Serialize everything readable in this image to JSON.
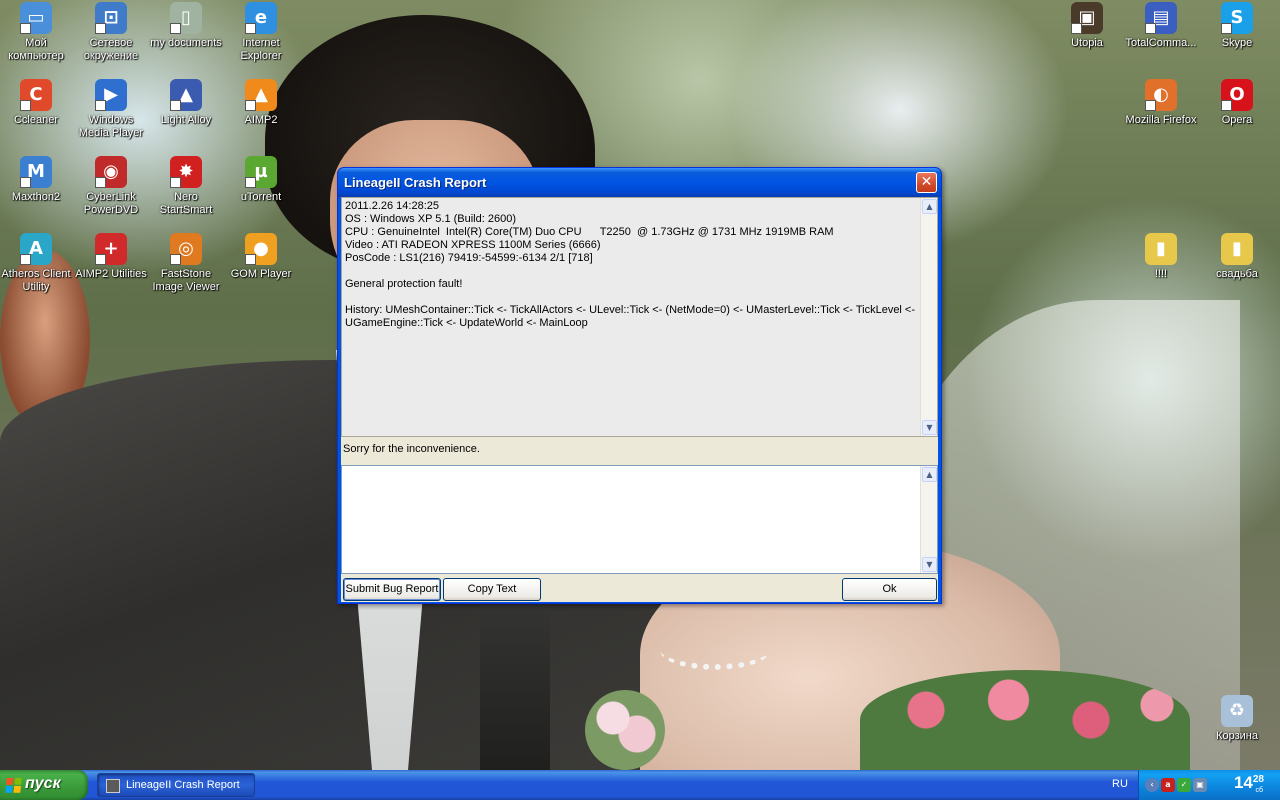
{
  "desktop": {
    "icons_left": [
      {
        "label": "Мой\nкомпьютер",
        "icon": "my-computer-icon",
        "color": "#4a8fd9",
        "glyph": "▭"
      },
      {
        "label": "Сетевое\nокружение",
        "icon": "network-icon",
        "color": "#3f7bc9",
        "glyph": "⊡"
      },
      {
        "label": "my documents",
        "icon": "documents-icon",
        "color": "#9fb3a0",
        "glyph": "▯"
      },
      {
        "label": "Internet\nExplorer",
        "icon": "ie-icon",
        "color": "#2f8fe0",
        "glyph": "e"
      },
      {
        "label": "Ccleaner",
        "icon": "ccleaner-icon",
        "color": "#e04a2a",
        "glyph": "C"
      },
      {
        "label": "Windows\nMedia Player",
        "icon": "media-player-icon",
        "color": "#2f6fd0",
        "glyph": "▶"
      },
      {
        "label": "Light Alloy",
        "icon": "light-alloy-icon",
        "color": "#3b5bb0",
        "glyph": "▲"
      },
      {
        "label": "AIMP2",
        "icon": "aimp2-icon",
        "color": "#f08a1a",
        "glyph": "▲"
      },
      {
        "label": "Maxthon2",
        "icon": "maxthon-icon",
        "color": "#3a7fd0",
        "glyph": "M"
      },
      {
        "label": "CyberLink\nPowerDVD",
        "icon": "powerdvd-icon",
        "color": "#c02a2a",
        "glyph": "◉"
      },
      {
        "label": "Nero\nStartSmart",
        "icon": "nero-icon",
        "color": "#d02020",
        "glyph": "✸"
      },
      {
        "label": "uTorrent",
        "icon": "utorrent-icon",
        "color": "#5aa832",
        "glyph": "µ"
      },
      {
        "label": "Atheros Client\nUtility",
        "icon": "atheros-icon",
        "color": "#2aa6c8",
        "glyph": "A"
      },
      {
        "label": "AIMP2 Utilities",
        "icon": "aimp2-utilities-icon",
        "color": "#d02a2a",
        "glyph": "+"
      },
      {
        "label": "FastStone\nImage Viewer",
        "icon": "faststone-icon",
        "color": "#e07a20",
        "glyph": "◎"
      },
      {
        "label": "GOM Player",
        "icon": "gom-player-icon",
        "color": "#f0a020",
        "glyph": "●"
      }
    ],
    "icons_right": [
      {
        "label": "Utopia",
        "icon": "utopia-icon",
        "color": "#4a3a2a",
        "glyph": "▣"
      },
      {
        "label": "TotalComma...",
        "icon": "total-commander-icon",
        "color": "#3a5fc0",
        "glyph": "▤"
      },
      {
        "label": "Skype",
        "icon": "skype-icon",
        "color": "#1aa0e8",
        "glyph": "S"
      },
      {
        "label": "Mozilla Firefox",
        "icon": "firefox-icon",
        "color": "#e0702a",
        "glyph": "◐"
      },
      {
        "label": "Opera",
        "icon": "opera-icon",
        "color": "#d8121a",
        "glyph": "O"
      },
      {
        "label": "!!!!",
        "icon": "folder-icon",
        "color": "#e8c84a",
        "glyph": "▮"
      },
      {
        "label": "свадьба",
        "icon": "folder-icon",
        "color": "#e8c84a",
        "glyph": "▮"
      },
      {
        "label": "Корзина",
        "icon": "recycle-bin-icon",
        "color": "#a8c0d8",
        "glyph": "♻"
      }
    ]
  },
  "dialog": {
    "title": "LineageII Crash Report",
    "report_lines": [
      "2011.2.26 14:28:25",
      "OS : Windows XP 5.1 (Build: 2600)",
      "CPU : GenuineIntel  Intel(R) Core(TM) Duo CPU      T2250  @ 1.73GHz @ 1731 MHz 1919MB RAM",
      "Video : ATI RADEON XPRESS 1100M Series (6666)",
      "PosCode : LS1(216) 79419:-54599:-6134 2/1 [718]",
      "",
      "General protection fault!",
      "",
      "History: UMeshContainer::Tick <- TickAllActors <- ULevel::Tick <- (NetMode=0) <- UMasterLevel::Tick <- TickLevel <-",
      "UGameEngine::Tick <- UpdateWorld <- MainLoop"
    ],
    "sorry_text": "Sorry for the inconvenience.",
    "input_value": "",
    "buttons": {
      "submit": "Submit Bug Report",
      "copy": "Copy Text",
      "ok": "Ok"
    }
  },
  "taskbar": {
    "start_label": "пуск",
    "task_label": "LineageII Crash Report",
    "language": "RU",
    "clock_hours": "14",
    "clock_minutes": "28",
    "clock_sub": "сб"
  }
}
